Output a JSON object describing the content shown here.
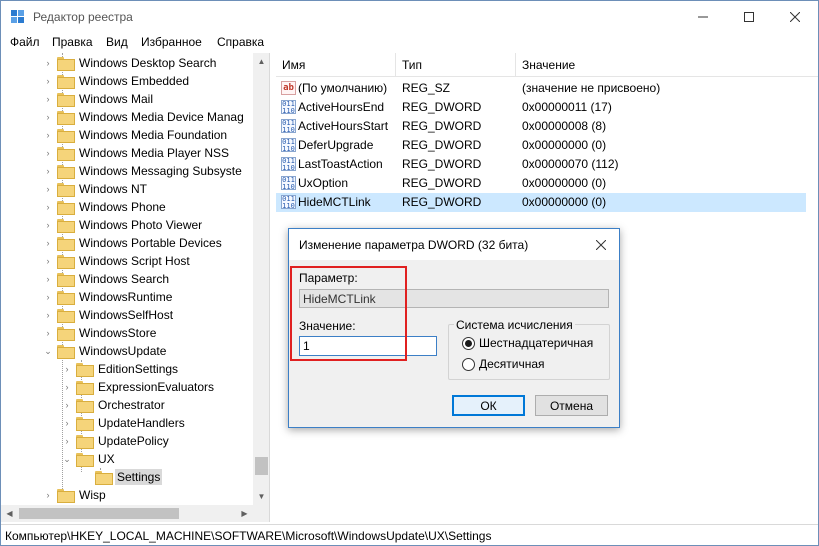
{
  "window": {
    "title": "Редактор реестра"
  },
  "menu": [
    "Файл",
    "Правка",
    "Вид",
    "Избранное",
    "Справка"
  ],
  "tree": [
    {
      "label": "Windows Desktop Search",
      "level": 0
    },
    {
      "label": "Windows Embedded",
      "level": 0
    },
    {
      "label": "Windows Mail",
      "level": 0
    },
    {
      "label": "Windows Media Device Manag",
      "level": 0
    },
    {
      "label": "Windows Media Foundation",
      "level": 0
    },
    {
      "label": "Windows Media Player NSS",
      "level": 0
    },
    {
      "label": "Windows Messaging Subsyste",
      "level": 0
    },
    {
      "label": "Windows NT",
      "level": 0
    },
    {
      "label": "Windows Phone",
      "level": 0
    },
    {
      "label": "Windows Photo Viewer",
      "level": 0
    },
    {
      "label": "Windows Portable Devices",
      "level": 0
    },
    {
      "label": "Windows Script Host",
      "level": 0
    },
    {
      "label": "Windows Search",
      "level": 0
    },
    {
      "label": "WindowsRuntime",
      "level": 0
    },
    {
      "label": "WindowsSelfHost",
      "level": 0
    },
    {
      "label": "WindowsStore",
      "level": 0
    },
    {
      "label": "WindowsUpdate",
      "level": 0
    },
    {
      "label": "EditionSettings",
      "level": 1
    },
    {
      "label": "ExpressionEvaluators",
      "level": 1
    },
    {
      "label": "Orchestrator",
      "level": 1
    },
    {
      "label": "UpdateHandlers",
      "level": 1
    },
    {
      "label": "UpdatePolicy",
      "level": 1
    },
    {
      "label": "UX",
      "level": 1
    },
    {
      "label": "Settings",
      "level": 2
    },
    {
      "label": "Wisp",
      "level": 0
    }
  ],
  "columns": {
    "name": "Имя",
    "type": "Тип",
    "value": "Значение"
  },
  "values": [
    {
      "name": "(По умолчанию)",
      "type": "REG_SZ",
      "data": "(значение не присвоено)",
      "icon": "string-value-icon"
    },
    {
      "name": "ActiveHoursEnd",
      "type": "REG_DWORD",
      "data": "0x00000011 (17)",
      "icon": "dword-value-icon"
    },
    {
      "name": "ActiveHoursStart",
      "type": "REG_DWORD",
      "data": "0x00000008 (8)",
      "icon": "dword-value-icon"
    },
    {
      "name": "DeferUpgrade",
      "type": "REG_DWORD",
      "data": "0x00000000 (0)",
      "icon": "dword-value-icon"
    },
    {
      "name": "LastToastAction",
      "type": "REG_DWORD",
      "data": "0x00000070 (112)",
      "icon": "dword-value-icon"
    },
    {
      "name": "UxOption",
      "type": "REG_DWORD",
      "data": "0x00000000 (0)",
      "icon": "dword-value-icon"
    },
    {
      "name": "HideMCTLink",
      "type": "REG_DWORD",
      "data": "0x00000000 (0)",
      "icon": "dword-value-icon"
    }
  ],
  "status": {
    "path": "Компьютер\\HKEY_LOCAL_MACHINE\\SOFTWARE\\Microsoft\\WindowsUpdate\\UX\\Settings"
  },
  "dialog": {
    "title": "Изменение параметра DWORD (32 бита)",
    "name_label": "Параметр:",
    "name_value": "HideMCTLink",
    "value_label": "Значение:",
    "value": "1",
    "base_label": "Система исчисления",
    "hex_label": "Шестнадцатеричная",
    "dec_label": "Десятичная",
    "ok": "ОК",
    "cancel": "Отмена"
  },
  "colors": {
    "accent": "#0078d7",
    "highlight": "#e02020",
    "selection": "#cce8ff"
  }
}
